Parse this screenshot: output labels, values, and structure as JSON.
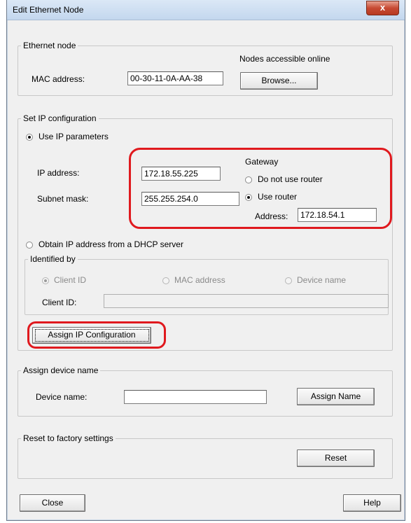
{
  "window": {
    "title": "Edit Ethernet Node",
    "close_glyph": "x"
  },
  "ethernet_node": {
    "legend": "Ethernet node",
    "nodes_accessible_label": "Nodes accessible online",
    "mac_label": "MAC address:",
    "mac_value": "00-30-11-0A-AA-38",
    "browse_label": "Browse..."
  },
  "ip_config": {
    "legend": "Set IP configuration",
    "use_ip_label": "Use IP parameters",
    "ip_label": "IP address:",
    "ip_value": "172.18.55.225",
    "subnet_label": "Subnet mask:",
    "subnet_value": "255.255.254.0",
    "gateway_label": "Gateway",
    "no_router_label": "Do not use router",
    "use_router_label": "Use router",
    "address_label": "Address:",
    "address_value": "172.18.54.1",
    "dhcp_label": "Obtain IP address from a DHCP server",
    "identified_by": {
      "legend": "Identified by",
      "client_id_option": "Client ID",
      "mac_option": "MAC address",
      "device_name_option": "Device name",
      "client_id_label": "Client ID:",
      "client_id_value": ""
    },
    "assign_button": "Assign IP Configuration"
  },
  "device_name": {
    "legend": "Assign device name",
    "label": "Device name:",
    "value": "",
    "assign_button": "Assign Name"
  },
  "reset": {
    "legend": "Reset to factory settings",
    "button": "Reset"
  },
  "footer": {
    "close_button": "Close",
    "help_button": "Help"
  },
  "colors": {
    "highlight": "#e0191e",
    "close_button": "#c74a33"
  }
}
